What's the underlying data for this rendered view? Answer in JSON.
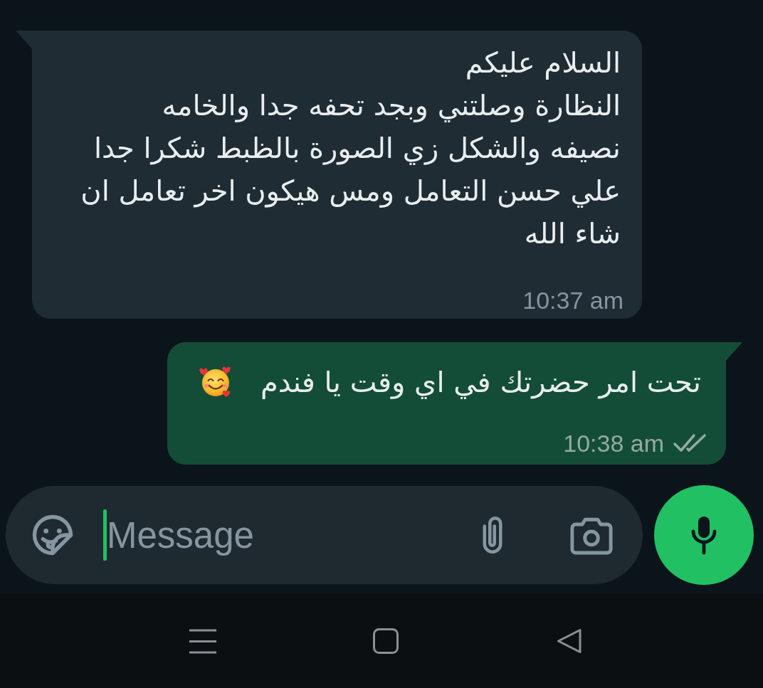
{
  "messages": [
    {
      "kind": "incoming",
      "text": "السلام عليكم\nالنظارة وصلتني وبجد تحفه جدا والخامه\nنصيفه والشكل زي الصورة بالظبط شكرا جدا\nعلي حسن التعامل ومس هيكون اخر تعامل ان\nشاء الله",
      "time": "10:37 am"
    },
    {
      "kind": "outgoing",
      "text": "تحت امر حضرتك في اي وقت يا فندم",
      "emoji": true,
      "time": "10:38 am",
      "delivered": true,
      "read": false
    }
  ],
  "composer": {
    "placeholder": "Message",
    "focused": true
  }
}
